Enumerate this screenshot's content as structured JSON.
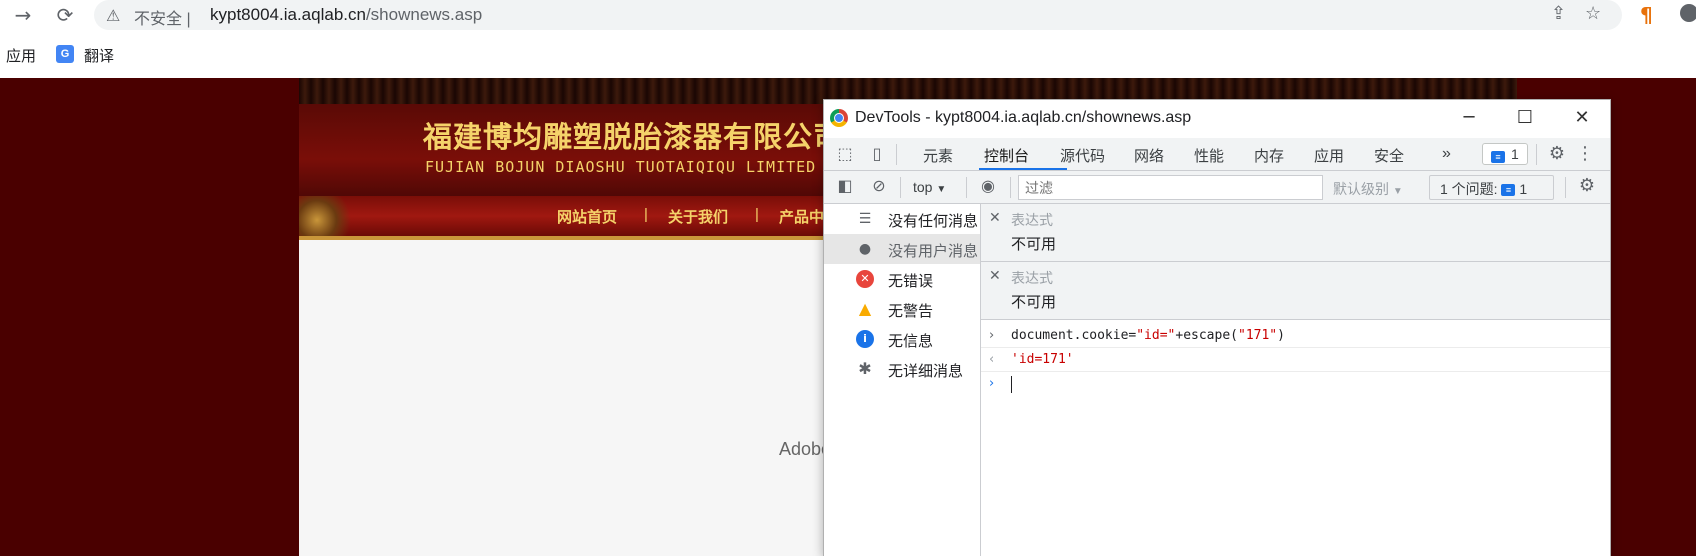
{
  "browser": {
    "security_label": "不安全",
    "separator": "|",
    "url_host": "kypt8004.ia.aqlab.cn",
    "url_path": "/shownews.asp",
    "bookmarks": {
      "apps": "应用",
      "translate": "翻译",
      "translate_icon_text": "G"
    }
  },
  "site": {
    "company_cn": "福建博均雕塑脱胎漆器有限公司",
    "company_en": "FUJIAN BOJUN DIAOSHU  TUOTAIQIQU  LIMITED COMPANY",
    "nav": [
      "网站首页",
      "关于我们",
      "产品中心"
    ],
    "nav_separator": "|",
    "adobe_text": "Adobe Flash Player"
  },
  "devtools": {
    "title": "DevTools - kypt8004.ia.aqlab.cn/shownews.asp",
    "tabs": [
      "元素",
      "控制台",
      "源代码",
      "网络",
      "性能",
      "内存",
      "应用",
      "安全"
    ],
    "active_tab": "控制台",
    "more_tabs": "»",
    "issues_badge_count": "1",
    "console_toolbar": {
      "context": "top",
      "filter_placeholder": "过滤",
      "level": "默认级别",
      "issues_label": "1 个问题:",
      "issues_count": "1"
    },
    "sidebar": [
      {
        "label": "没有任何消息",
        "icon": "list-icon"
      },
      {
        "label": "没有用户消息",
        "icon": "user-icon"
      },
      {
        "label": "无错误",
        "icon": "error-icon"
      },
      {
        "label": "无警告",
        "icon": "warning-icon"
      },
      {
        "label": "无信息",
        "icon": "info-icon"
      },
      {
        "label": "无详细消息",
        "icon": "bug-icon"
      }
    ],
    "live_expressions": [
      {
        "label": "表达式",
        "value": "不可用"
      },
      {
        "label": "表达式",
        "value": "不可用"
      }
    ],
    "console": {
      "input_code_prefix": "document.cookie=",
      "input_code_str1": "\"id=\"",
      "input_code_mid": "+escape(",
      "input_code_str2": "\"171\"",
      "input_code_suffix": ")",
      "result": "'id=171'"
    }
  },
  "colors": {
    "page_bg": "#4a0000",
    "accent_blue": "#1a73e8",
    "gold": "#f5d36a",
    "error_red": "#e8453c",
    "warning_yellow": "#f9ab00",
    "info_blue": "#1a73e8"
  }
}
